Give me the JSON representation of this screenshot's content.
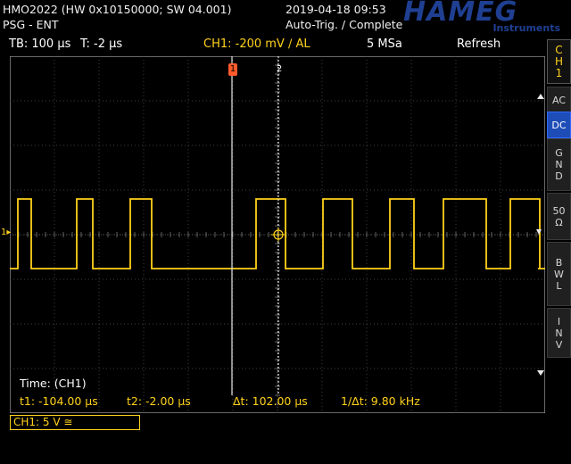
{
  "header": {
    "device": "HMO2022 (HW 0x10150000; SW 04.001)",
    "mode": "PSG - ENT",
    "datetime": "2019-04-18 09:53",
    "trigger_status": "Auto-Trig. / Complete",
    "brand": "HAMEG",
    "brand_sub": "Instruments"
  },
  "statusbar": {
    "timebase": "TB: 100 µs",
    "trigger_time": "T: -2 µs",
    "trigger_setting": "CH1: -200 mV ∕ AL",
    "sample_rate": "5 MSa",
    "acq_mode": "Refresh"
  },
  "markers": {
    "cursor1": "1",
    "cursor2": "2",
    "ch_level": "1"
  },
  "measurements": {
    "title": "Time: (CH1)",
    "t1": "t1: -104.00 µs",
    "t2": "t2: -2.00 µs",
    "dt": "Δt: 102.00 µs",
    "inv_dt": "1/Δt: 9.80 kHz"
  },
  "channel_box": "CH1: 5 V ≅",
  "right_panel": {
    "channel": [
      "C",
      "H",
      "1"
    ],
    "buttons": [
      {
        "label": "AC",
        "active": false
      },
      {
        "label": "DC",
        "active": true
      },
      {
        "label": "G N D",
        "active": false
      },
      {
        "label": "50 Ω",
        "active": false
      },
      {
        "label": "B W L",
        "active": false
      },
      {
        "label": "I N V",
        "active": false
      }
    ]
  },
  "colors": {
    "trace": "#ffd21a",
    "cursor_marker": "#ff5a2a",
    "active_button": "#1e4db7",
    "brand": "#1f3f92"
  },
  "waveform": {
    "edges_div": [
      0.3,
      0.8,
      2.5,
      3.1,
      4.5,
      5.3,
      9.2,
      10.3,
      11.7,
      12.8,
      14.2,
      15.1,
      16.2,
      17.8,
      18.7,
      19.8
    ],
    "high_div": -1.0,
    "low_div": 1.0
  }
}
